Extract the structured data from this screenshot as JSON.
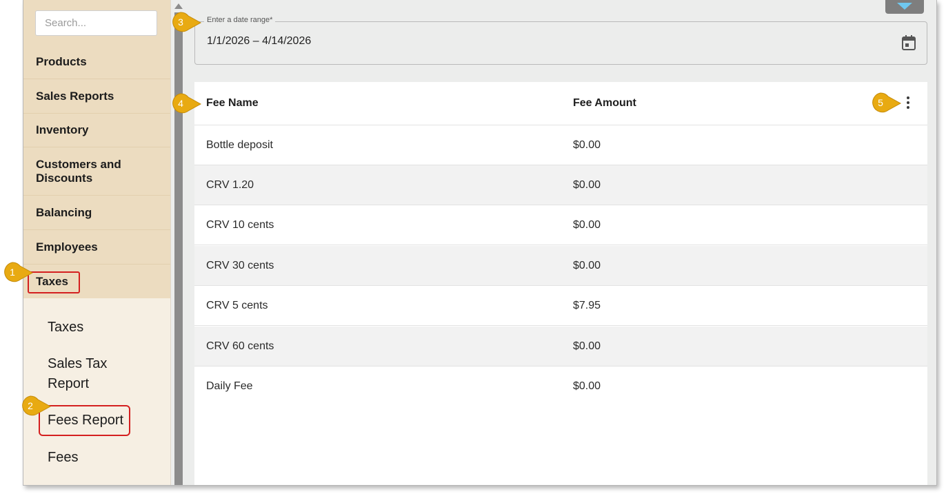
{
  "sidebar": {
    "search_placeholder": "Search...",
    "nav": [
      {
        "label": "Products"
      },
      {
        "label": "Sales Reports"
      },
      {
        "label": "Inventory"
      },
      {
        "label": "Customers and Discounts"
      },
      {
        "label": "Balancing"
      },
      {
        "label": "Employees"
      },
      {
        "label": "Taxes"
      }
    ],
    "sub": [
      {
        "label": "Taxes"
      },
      {
        "label": "Sales Tax Report"
      },
      {
        "label": "Fees Report"
      },
      {
        "label": "Fees"
      }
    ]
  },
  "date_range": {
    "label": "Enter a date range*",
    "value": "1/1/2026 – 4/14/2026",
    "icon": "calendar-icon"
  },
  "table": {
    "headers": {
      "name": "Fee Name",
      "amount": "Fee Amount"
    },
    "rows": [
      {
        "name": "Bottle deposit",
        "amount": "$0.00"
      },
      {
        "name": "CRV 1.20",
        "amount": "$0.00"
      },
      {
        "name": "CRV 10 cents",
        "amount": "$0.00"
      },
      {
        "name": "CRV 30 cents",
        "amount": "$0.00"
      },
      {
        "name": "CRV 5 cents",
        "amount": "$7.95"
      },
      {
        "name": "CRV 60 cents",
        "amount": "$0.00"
      },
      {
        "name": "Daily Fee",
        "amount": "$0.00"
      }
    ],
    "menu_icon": "more-vert-icon"
  },
  "callouts": {
    "c1": "1",
    "c2": "2",
    "c3": "3",
    "c4": "4",
    "c5": "5"
  },
  "colors": {
    "callout": "#e8aa12",
    "highlight": "#d41f1f",
    "nav_bg": "#ecdcc0",
    "sub_bg": "#f6efe3"
  }
}
